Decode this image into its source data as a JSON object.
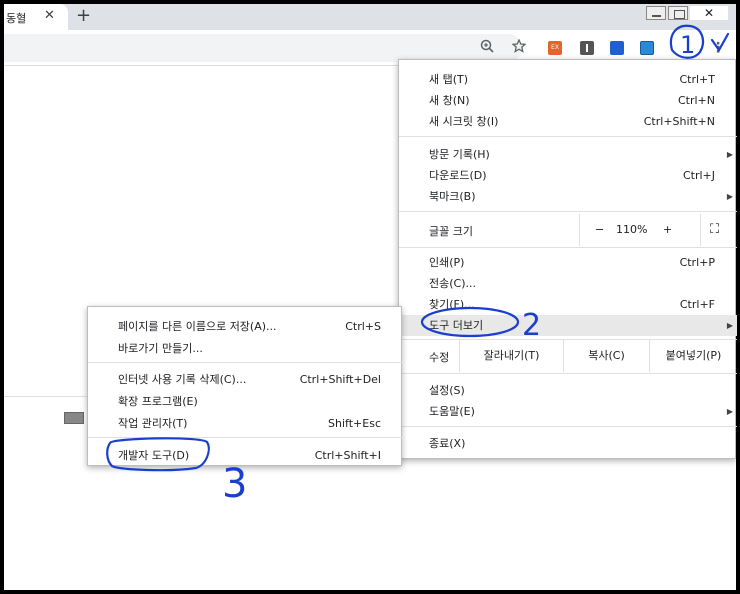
{
  "tab": {
    "title": "동혈",
    "close": "✕"
  },
  "new_tab": "+",
  "window": {
    "close": "✕"
  },
  "toolbar": {
    "zoom_icon": "zoom-icon",
    "star_icon": "bookmark-star-icon",
    "ext1_label": "EX",
    "kebab": "⋮"
  },
  "menu": {
    "new_tab": {
      "label": "새 탭(T)",
      "shortcut": "Ctrl+T"
    },
    "new_window": {
      "label": "새 창(N)",
      "shortcut": "Ctrl+N"
    },
    "incognito": {
      "label": "새 시크릿 창(I)",
      "shortcut": "Ctrl+Shift+N"
    },
    "history": {
      "label": "방문 기록(H)"
    },
    "downloads": {
      "label": "다운로드(D)",
      "shortcut": "Ctrl+J"
    },
    "bookmarks": {
      "label": "북마크(B)"
    },
    "zoom": {
      "label": "글꼴 크기",
      "minus": "−",
      "value": "110%",
      "plus": "+",
      "fullscreen": "⛶"
    },
    "print": {
      "label": "인쇄(P)",
      "shortcut": "Ctrl+P"
    },
    "cast": {
      "label": "전송(C)..."
    },
    "find": {
      "label": "찾기(F)...",
      "shortcut": "Ctrl+F"
    },
    "more_tools": {
      "label": "도구 더보기"
    },
    "edit": {
      "label": "수정",
      "cut": "잘라내기(T)",
      "copy": "복사(C)",
      "paste": "붙여넣기(P)"
    },
    "settings": {
      "label": "설정(S)"
    },
    "help": {
      "label": "도움말(E)"
    },
    "exit": {
      "label": "종료(X)"
    }
  },
  "submenu": {
    "save_page": {
      "label": "페이지를 다른 이름으로 저장(A)...",
      "shortcut": "Ctrl+S"
    },
    "create_shortcut": {
      "label": "바로가기 만들기..."
    },
    "clear_data": {
      "label": "인터넷 사용 기록 삭제(C)...",
      "shortcut": "Ctrl+Shift+Del"
    },
    "extensions": {
      "label": "확장 프로그램(E)"
    },
    "task_manager": {
      "label": "작업 관리자(T)",
      "shortcut": "Shift+Esc"
    },
    "dev_tools": {
      "label": "개발자 도구(D)",
      "shortcut": "Ctrl+Shift+I"
    }
  },
  "annotations": {
    "a1": "1",
    "a2": "2",
    "a3": "3"
  },
  "colors": {
    "annotation": "#1a3fcf",
    "ext_orange": "#e8632b",
    "ext_blue": "#1e5fd1"
  }
}
